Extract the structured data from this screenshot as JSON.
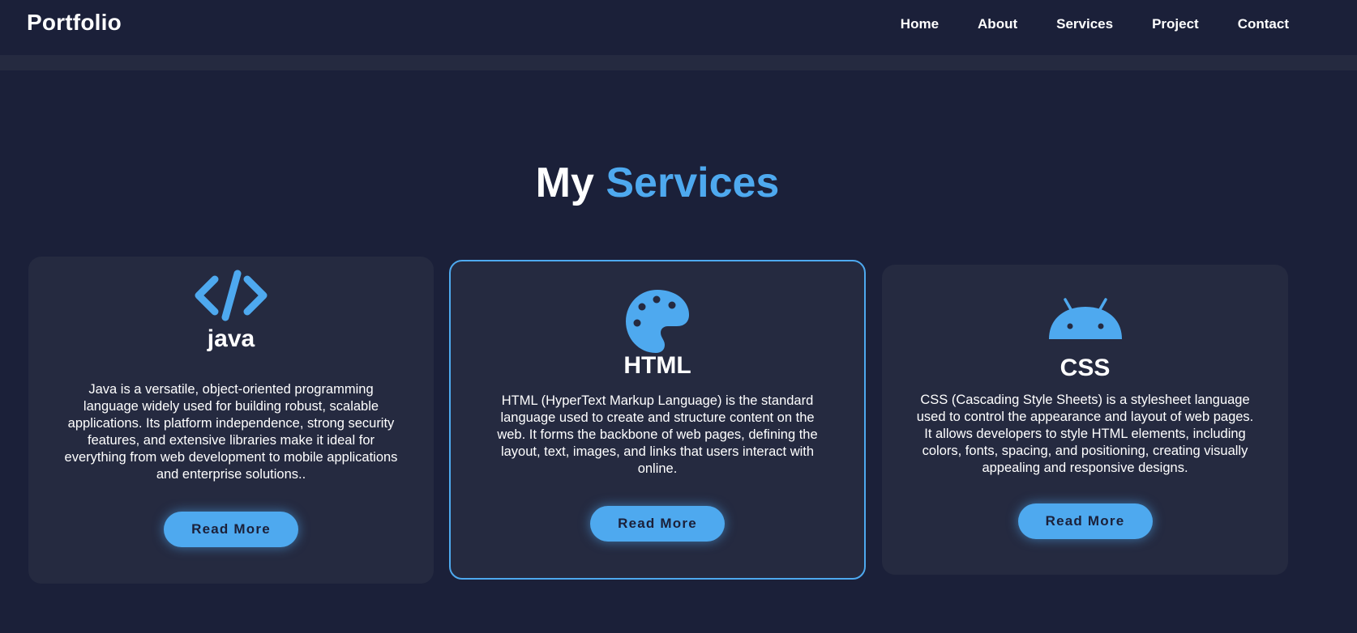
{
  "header": {
    "logo": "Portfolio",
    "nav": [
      "Home",
      "About",
      "Services",
      "Project",
      "Contact"
    ]
  },
  "section": {
    "title_main": "My",
    "title_accent": "Services"
  },
  "cards": [
    {
      "icon": "code-icon",
      "title": "java",
      "lines": [
        "Java is a versatile, object-oriented programming",
        "language widely used for building robust, scalable",
        "applications. Its platform independence, strong security",
        "features, and extensive libraries make it ideal for",
        "everything from web development to mobile applications",
        "and enterprise solutions.."
      ],
      "button": "Read More"
    },
    {
      "icon": "palette-icon",
      "title": "HTML",
      "lines": [
        "HTML (HyperText Markup Language) is the standard",
        "language used to create and structure content on the",
        "web. It forms the backbone of web pages, defining the",
        "layout, text, images, and links that users interact with",
        "online."
      ],
      "button": "Read More"
    },
    {
      "icon": "android-icon",
      "title": "CSS",
      "lines": [
        "CSS (Cascading Style Sheets) is a stylesheet language",
        "used to control the appearance and layout of web pages.",
        "It allows developers to style HTML elements, including",
        "colors, fonts, spacing, and positioning, creating visually",
        "appealing and responsive designs."
      ],
      "button": "Read More"
    }
  ],
  "colors": {
    "background": "#1b2039",
    "card": "#252a40",
    "accent": "#4ea9ef",
    "text": "#ffffff"
  }
}
